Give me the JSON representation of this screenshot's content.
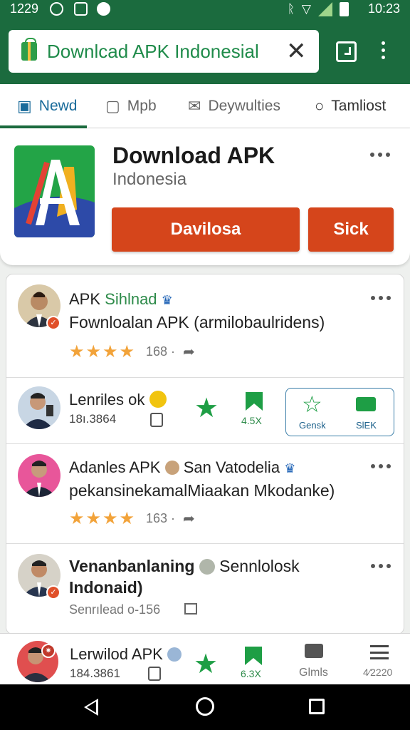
{
  "status_bar": {
    "time": "1229",
    "clock": "10:23"
  },
  "search": {
    "query": "Downlcad APK Indonesial",
    "clear_icon": "close-icon"
  },
  "tabs": [
    {
      "label": "Newd",
      "icon": "calendar-icon"
    },
    {
      "label": "Mpb",
      "icon": "chat-icon"
    },
    {
      "label": "Deywulties",
      "icon": "mail-icon"
    },
    {
      "label": "Tamliost",
      "icon": "location-icon"
    }
  ],
  "app": {
    "title": "Download APK",
    "subtitle": "Indonesia",
    "primary_button": "Davilosa",
    "secondary_button": "Sick"
  },
  "list": [
    {
      "name_prefix": "APK",
      "name_highlight": "Sihlnad",
      "subtitle": "Fownloalan APK (armilobaulridens)",
      "rating_stars": 4,
      "count": "168"
    },
    {
      "name": "Lenriles ok",
      "number": "18ı.3864",
      "flag_value": "4.5X",
      "box_left_label": "Gensk",
      "box_right_label": "SlEK"
    },
    {
      "name": "Adanles APK",
      "name_suffix": "San Vatodelia",
      "subtitle": "pekansinekamalMiaakan Mkodanke)",
      "rating_stars": 4,
      "count": "163"
    },
    {
      "name": "Venanbanlaning",
      "name_suffix": "Sennlolosk",
      "line2": "Indonaid)",
      "meta": "Senrılead o-156"
    }
  ],
  "bottom_bar": {
    "name": "Lerwilod APK",
    "number": "184.3861",
    "flag_value": "6.3X",
    "tab3_label": "Glmls",
    "tab4_label": "4⁄2220"
  },
  "colors": {
    "brand": "#1b6b3e",
    "accent": "#d5451b",
    "star": "#f2a33a",
    "link": "#1a6b9a"
  }
}
